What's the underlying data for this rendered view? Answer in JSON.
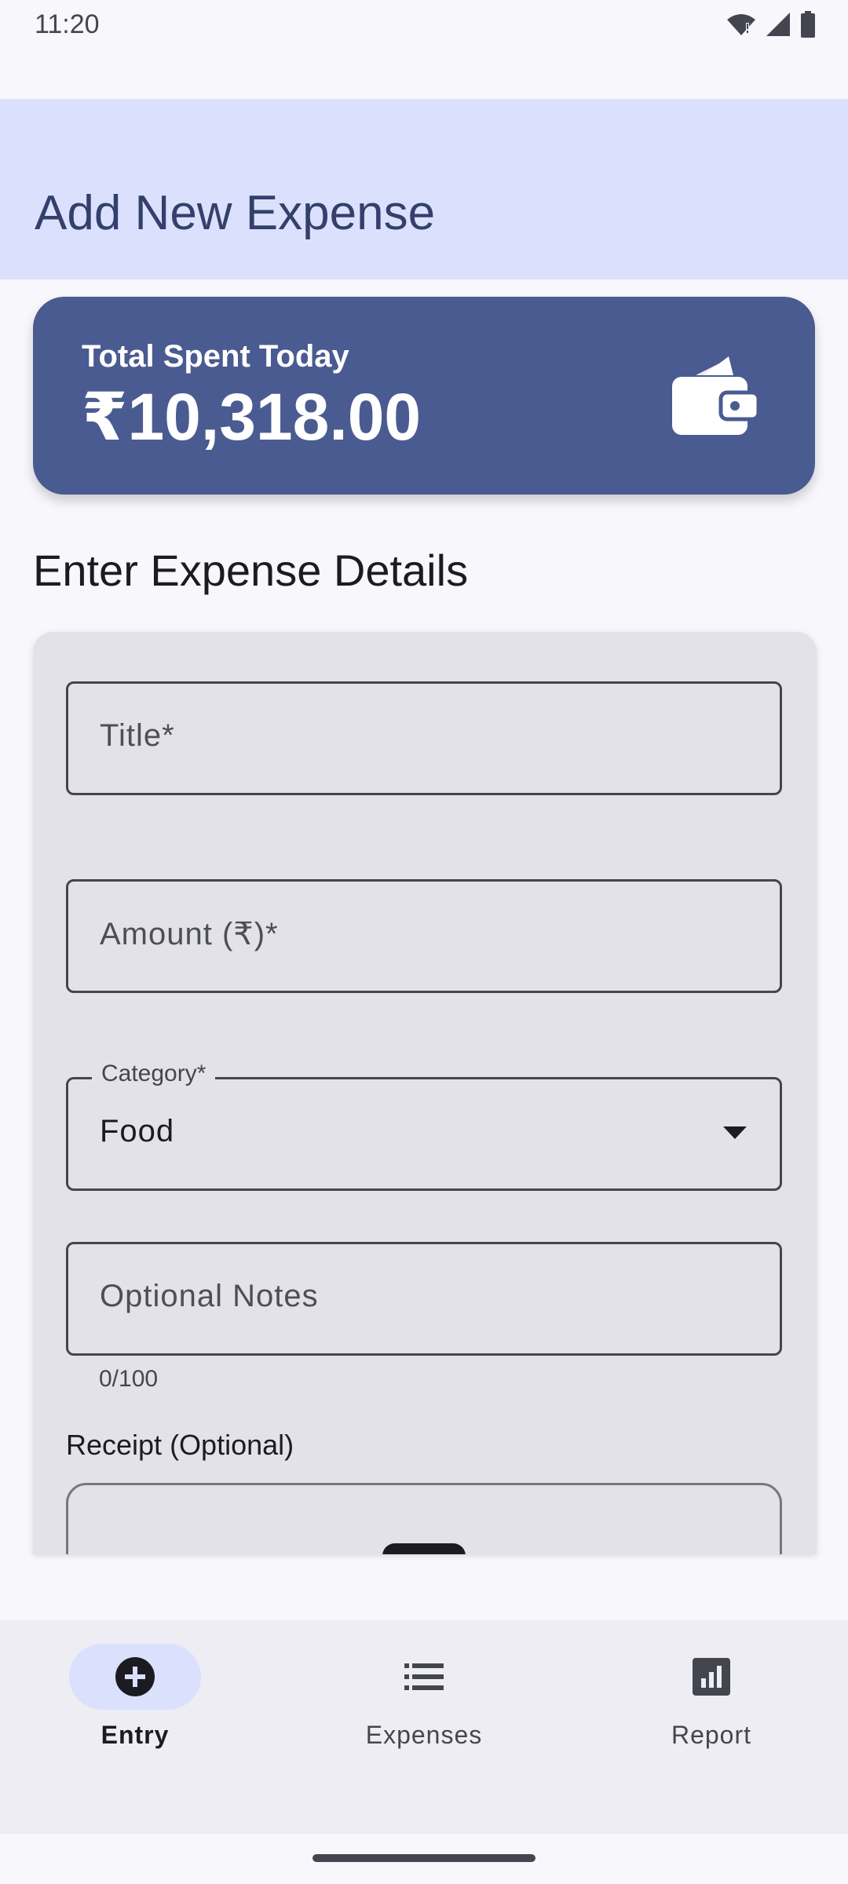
{
  "status_bar": {
    "time": "11:20",
    "icons": [
      "wifi-icon",
      "signal-icon",
      "battery-icon"
    ]
  },
  "top_bar": {
    "title": "Add New Expense"
  },
  "summary": {
    "label": "Total Spent Today",
    "amount": "₹10,318.00",
    "icon": "wallet-icon"
  },
  "section_heading": "Enter Expense Details",
  "form": {
    "title_placeholder": "Title*",
    "amount_placeholder": "Amount (₹)*",
    "category_label": "Category*",
    "category_value": "Food",
    "notes_placeholder": "Optional Notes",
    "notes_counter": "0/100",
    "receipt_label": "Receipt (Optional)"
  },
  "bottom_nav": {
    "items": [
      {
        "label": "Entry",
        "icon": "add-circle-icon",
        "active": true
      },
      {
        "label": "Expenses",
        "icon": "list-icon",
        "active": false
      },
      {
        "label": "Report",
        "icon": "report-chart-icon",
        "active": false
      }
    ]
  },
  "colors": {
    "accent": "#4a5b91",
    "top_bar_bg": "#dbe1fd",
    "background": "#f8f7fc",
    "form_card_bg": "#e3e2e8"
  }
}
